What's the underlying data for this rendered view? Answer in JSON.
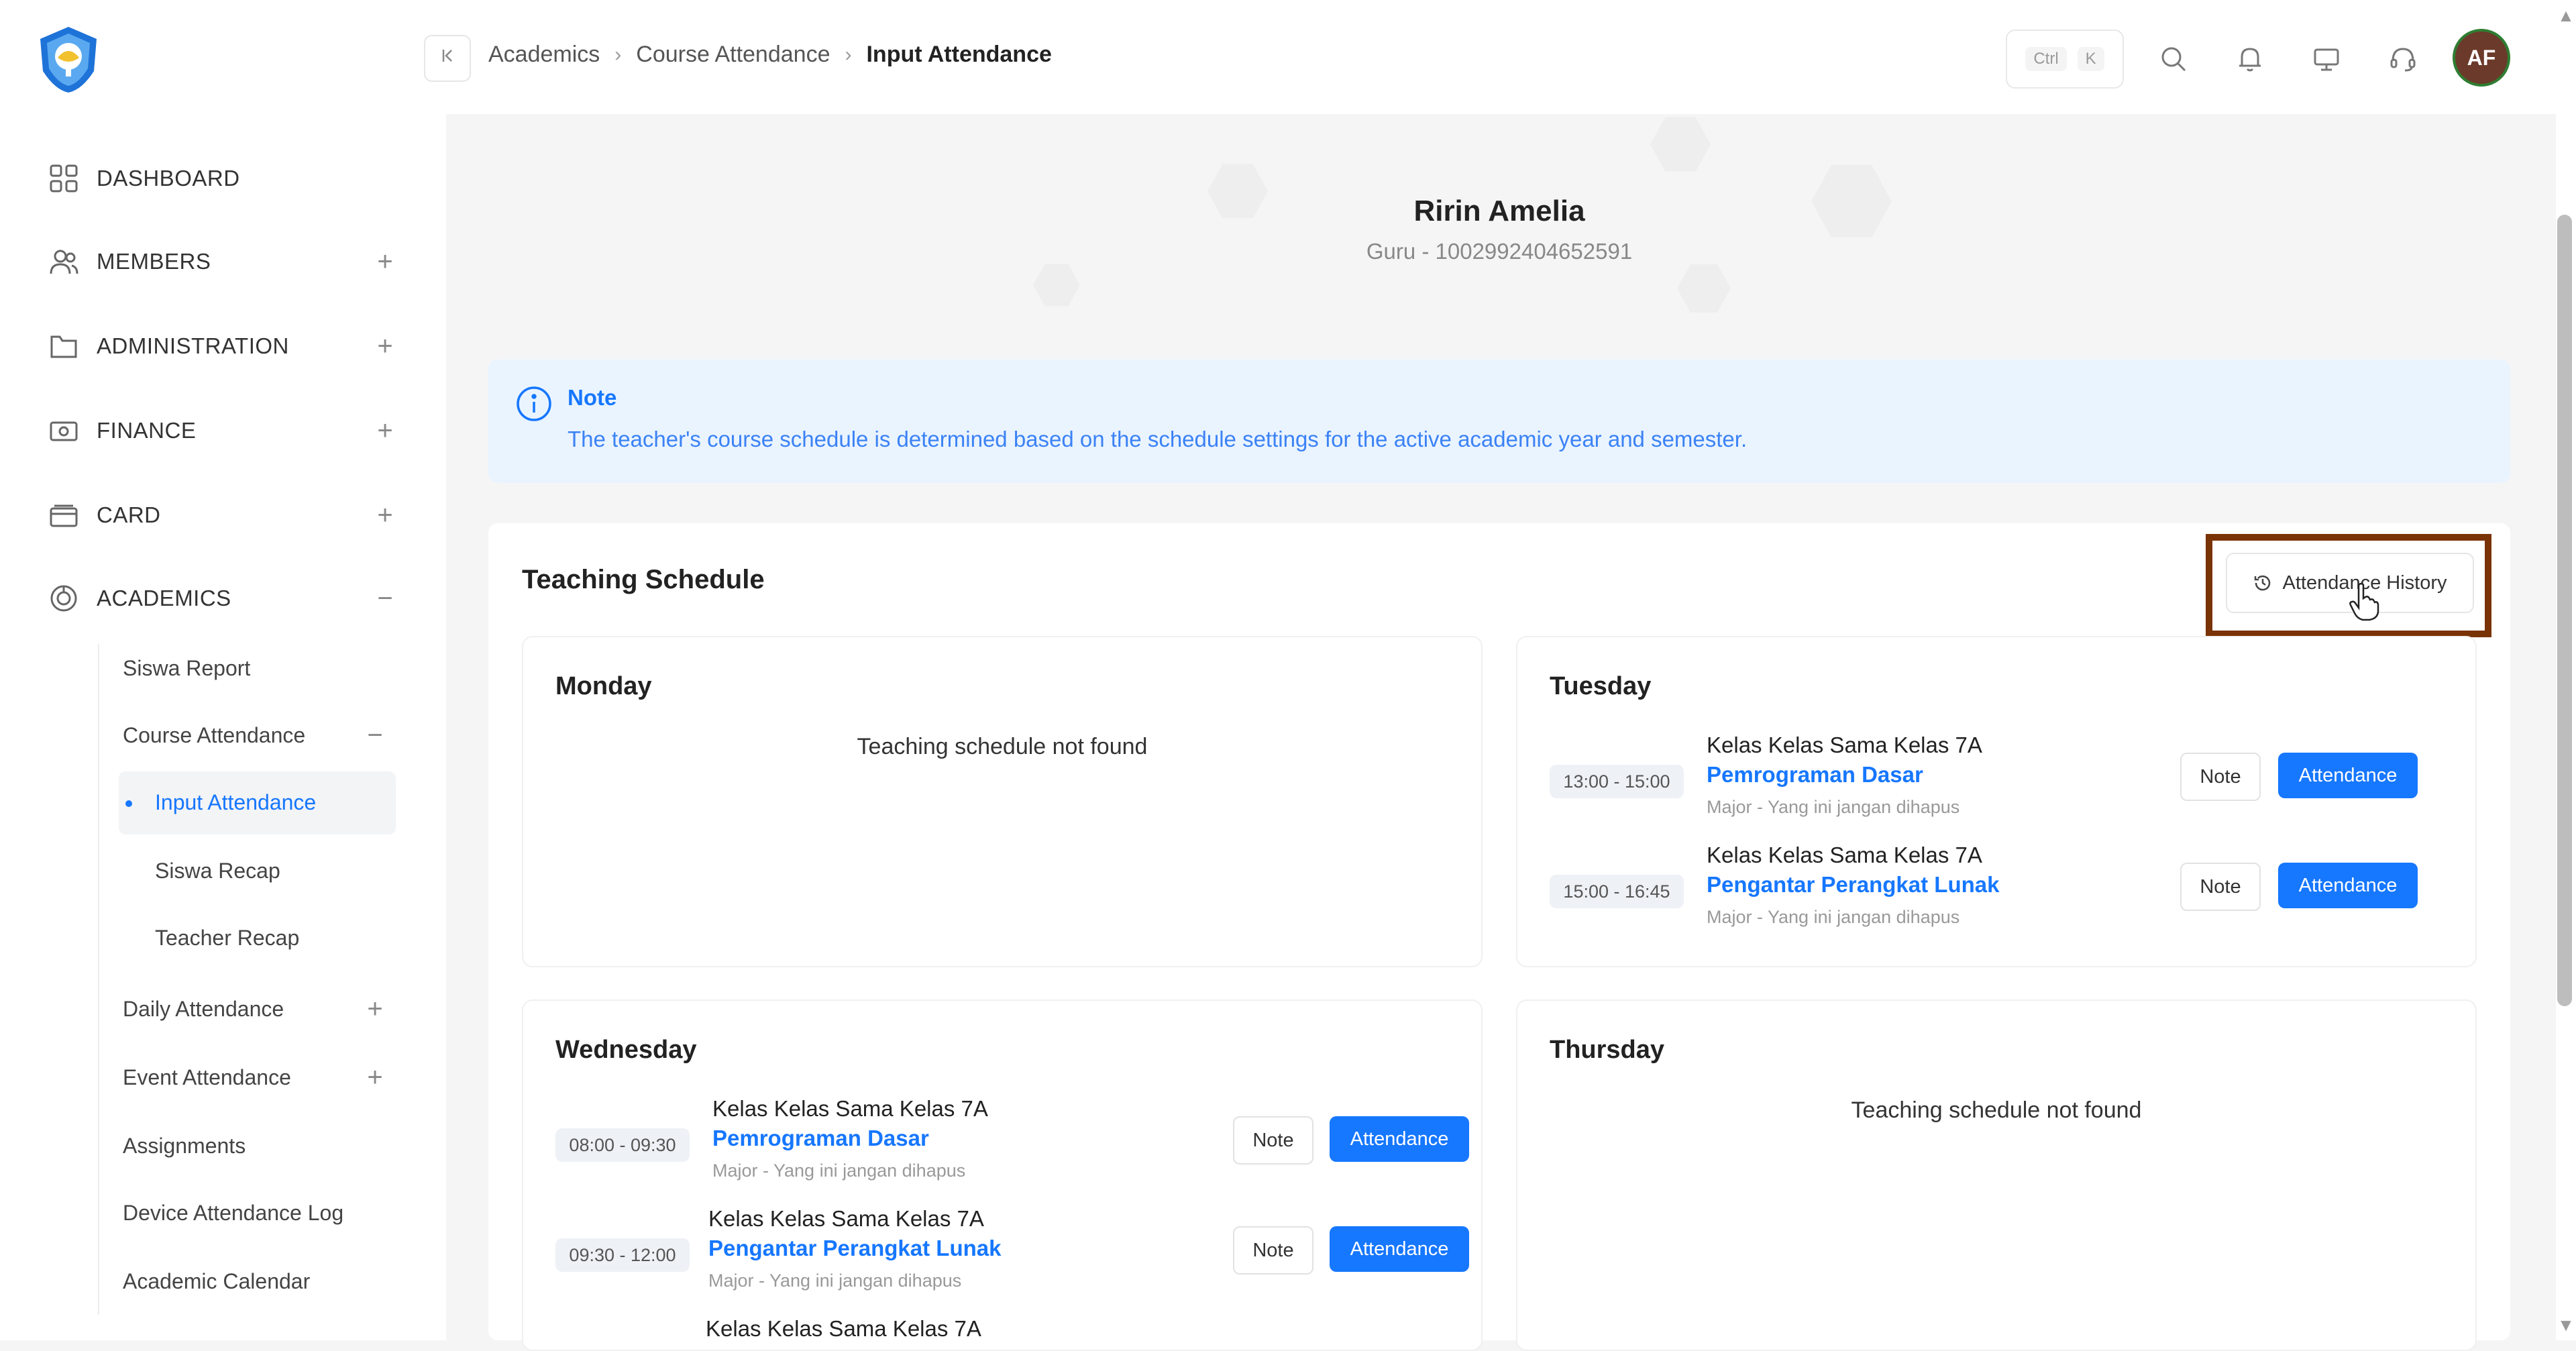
{
  "sidebar": {
    "logo": "tut-wuri-handayani-logo",
    "items": [
      {
        "label": "DASHBOARD",
        "icon": "grid-icon",
        "expand": ""
      },
      {
        "label": "MEMBERS",
        "icon": "users-icon",
        "expand": "+"
      },
      {
        "label": "ADMINISTRATION",
        "icon": "folder-icon",
        "expand": "+"
      },
      {
        "label": "FINANCE",
        "icon": "money-icon",
        "expand": "+"
      },
      {
        "label": "CARD",
        "icon": "card-icon",
        "expand": "+"
      },
      {
        "label": "ACADEMICS",
        "icon": "academics-icon",
        "expand": "−"
      }
    ],
    "sub": {
      "siswa_report": "Siswa Report",
      "course_attendance": "Course Attendance",
      "course_attendance_expand": "−",
      "input_attendance": "Input Attendance",
      "siswa_recap": "Siswa Recap",
      "teacher_recap": "Teacher Recap",
      "daily_attendance": "Daily Attendance",
      "daily_attendance_expand": "+",
      "event_attendance": "Event Attendance",
      "event_attendance_expand": "+",
      "assignments": "Assignments",
      "device_log": "Device Attendance Log",
      "academic_calendar": "Academic Calendar"
    }
  },
  "header": {
    "breadcrumb": [
      "Academics",
      "Course Attendance",
      "Input Attendance"
    ],
    "shortcut": [
      "Ctrl",
      "K"
    ],
    "avatar": "AF",
    "accent": "#1677ff"
  },
  "profile": {
    "name": "Ririn Amelia",
    "subtitle": "Guru - 1002992404652591"
  },
  "note": {
    "title": "Note",
    "text": "The teacher's course schedule is determined based on the schedule settings for the active academic year and semester."
  },
  "schedule": {
    "title": "Teaching Schedule",
    "history_label": "Attendance History",
    "note_label": "Note",
    "attendance_label": "Attendance",
    "empty_text": "Teaching schedule not found",
    "days": {
      "monday": {
        "name": "Monday"
      },
      "tuesday": {
        "name": "Tuesday",
        "slots": [
          {
            "time": "13:00 - 15:00",
            "class": "Kelas Kelas Sama Kelas 7A",
            "course": "Pemrograman Dasar",
            "major": "Major - Yang ini jangan dihapus"
          },
          {
            "time": "15:00 - 16:45",
            "class": "Kelas Kelas Sama Kelas 7A",
            "course": "Pengantar Perangkat Lunak",
            "major": "Major - Yang ini jangan dihapus"
          }
        ]
      },
      "wednesday": {
        "name": "Wednesday",
        "slots": [
          {
            "time": "08:00 - 09:30",
            "class": "Kelas Kelas Sama Kelas 7A",
            "course": "Pemrograman Dasar",
            "major": "Major - Yang ini jangan dihapus"
          },
          {
            "time": "09:30 - 12:00",
            "class": "Kelas Kelas Sama Kelas 7A",
            "course": "Pengantar Perangkat Lunak",
            "major": "Major - Yang ini jangan dihapus"
          },
          {
            "class": "Kelas Kelas Sama Kelas 7A"
          }
        ]
      },
      "thursday": {
        "name": "Thursday"
      }
    }
  }
}
